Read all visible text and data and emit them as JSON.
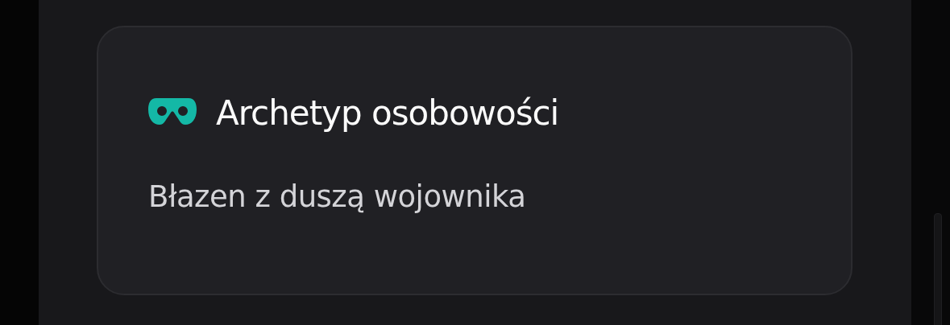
{
  "card": {
    "title": "Archetyp osobowości",
    "value": "Błazen z duszą wojownika"
  }
}
